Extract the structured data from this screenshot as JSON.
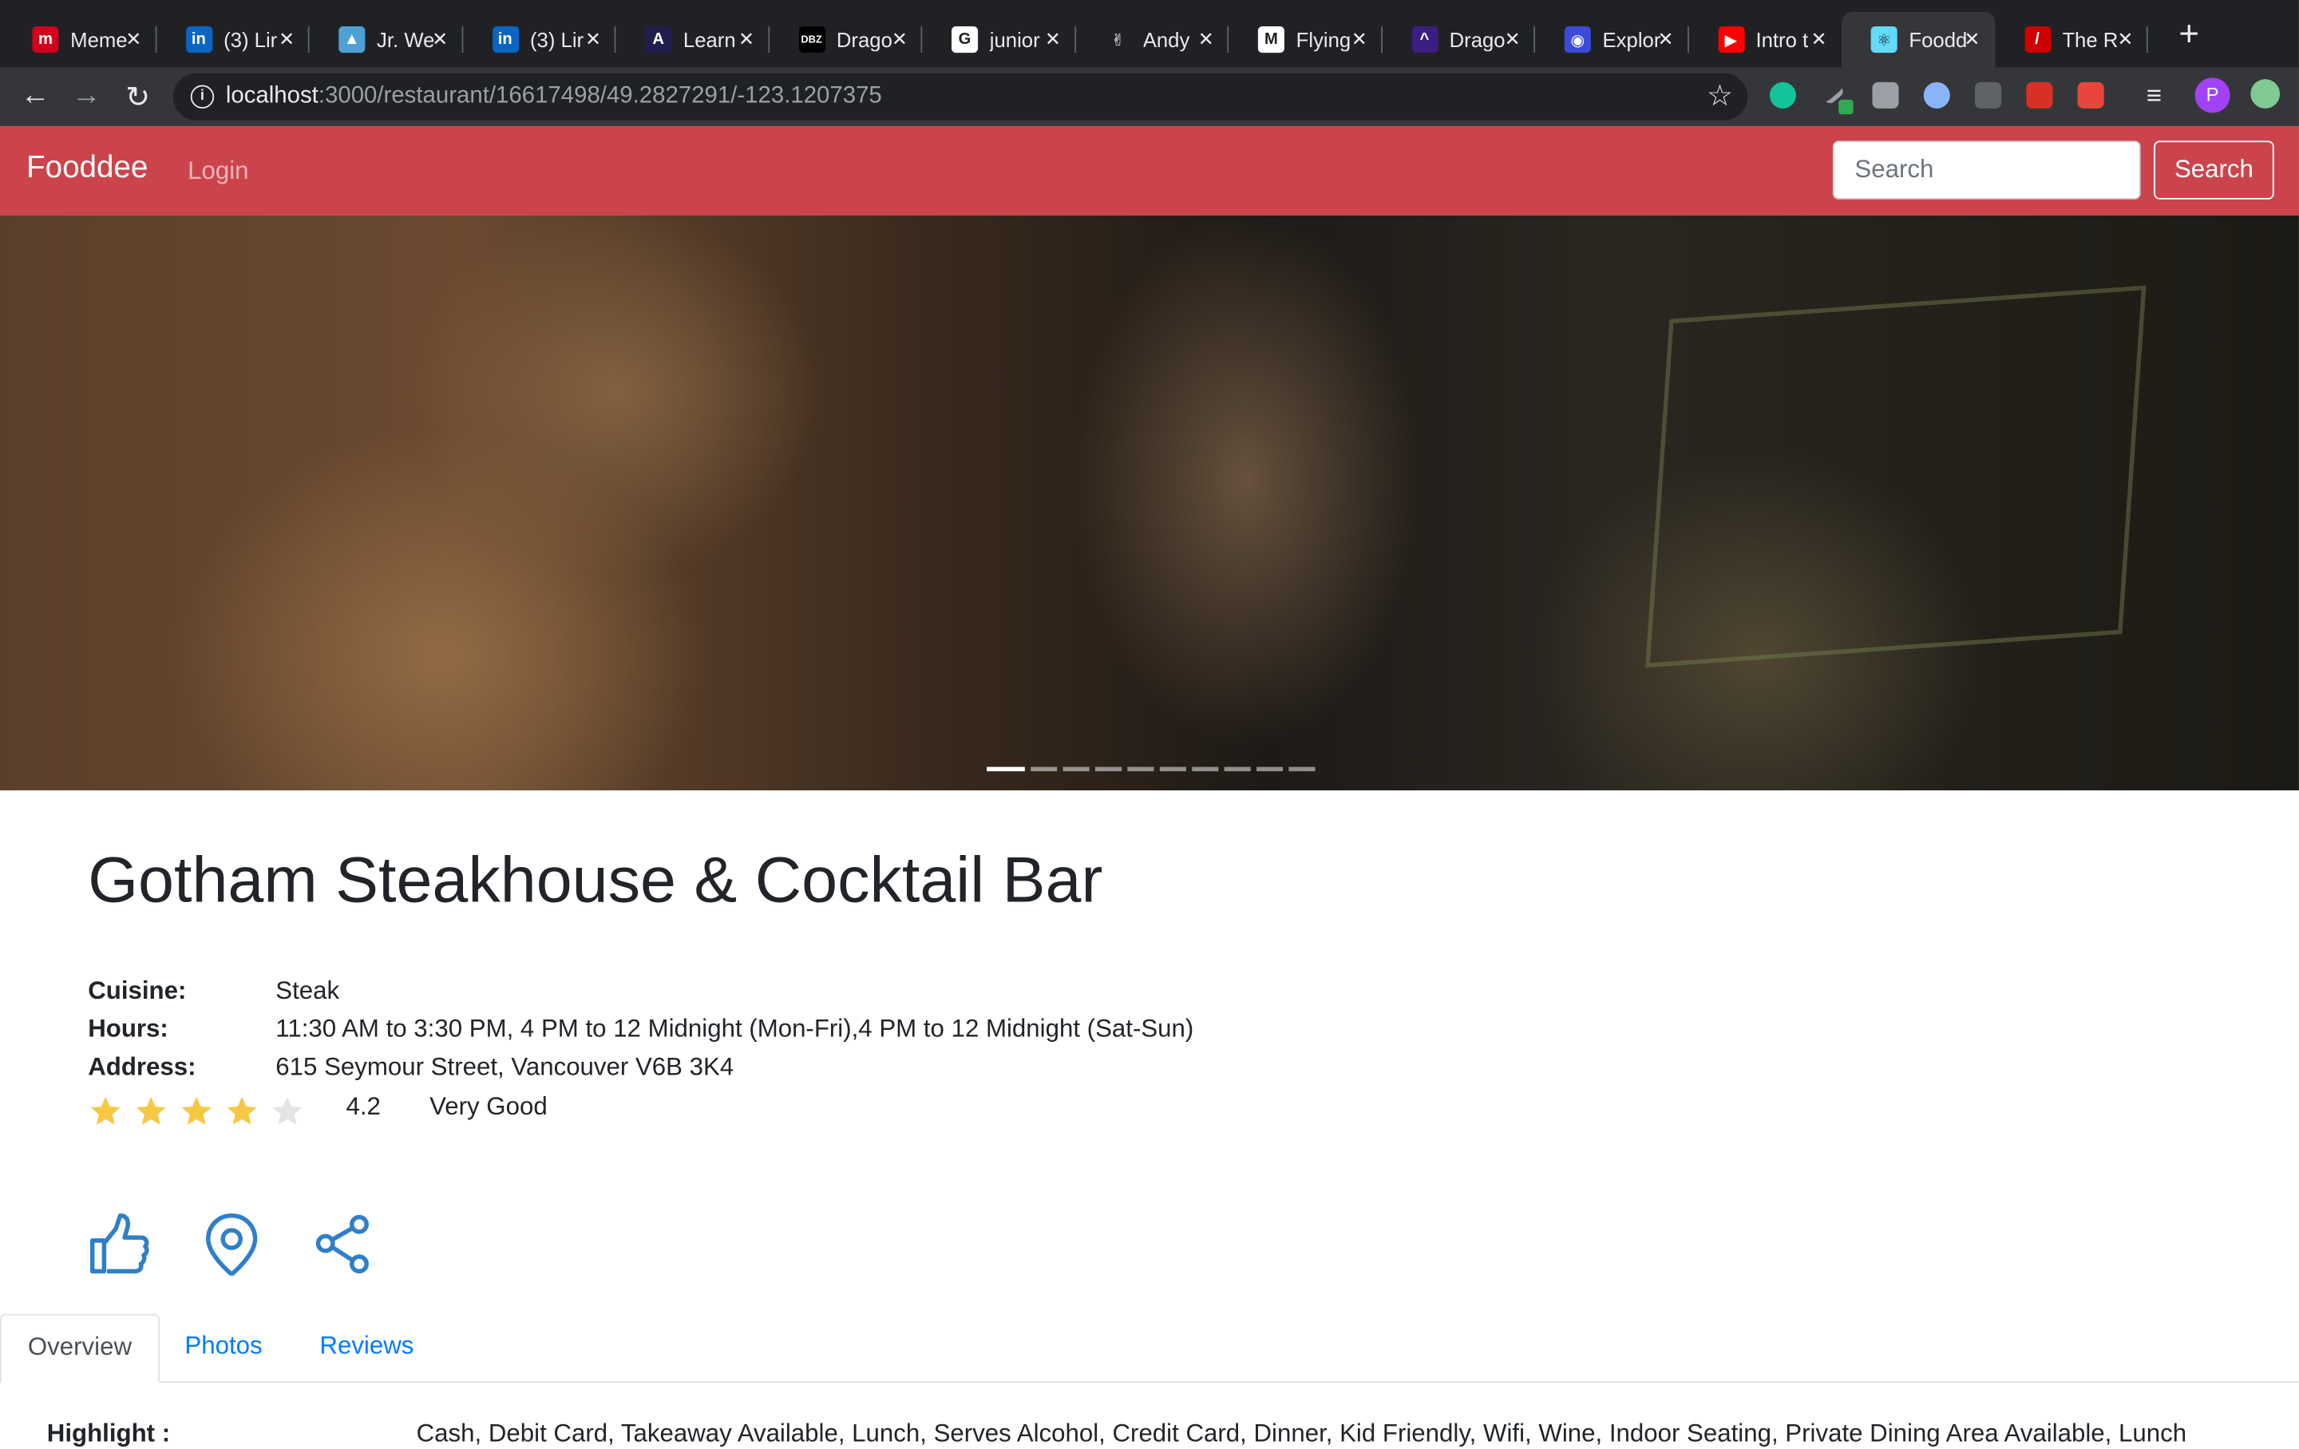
{
  "browser": {
    "tabs": [
      {
        "title": "Meme",
        "icon": "imgflip-icon",
        "color": "#d0021b",
        "glyph": "m"
      },
      {
        "title": "(3) Lir",
        "icon": "linkedin-icon",
        "color": "#0a66c2",
        "glyph": "in"
      },
      {
        "title": "Jr. We",
        "icon": "triangle-icon",
        "color": "#4ea1d3",
        "glyph": "▲"
      },
      {
        "title": "(3) Lir",
        "icon": "linkedin-icon",
        "color": "#0a66c2",
        "glyph": "in"
      },
      {
        "title": "Learn",
        "icon": "codecademy-icon",
        "color": "#1f1f4f",
        "glyph": "A"
      },
      {
        "title": "Drago",
        "icon": "dbz-icon",
        "color": "#000000",
        "glyph": "DBZ"
      },
      {
        "title": "junior",
        "icon": "google-icon",
        "color": "#ffffff",
        "glyph": "G"
      },
      {
        "title": "Andy",
        "icon": "peace-hand-icon",
        "color": "#202124",
        "glyph": "✌"
      },
      {
        "title": "Flying",
        "icon": "gmail-icon",
        "color": "#ffffff",
        "glyph": "M"
      },
      {
        "title": "Drago",
        "icon": "dragon-icon",
        "color": "#3c1e82",
        "glyph": "^"
      },
      {
        "title": "Explor",
        "icon": "discord-icon",
        "color": "#3b4bd8",
        "glyph": "◉"
      },
      {
        "title": "Intro t",
        "icon": "youtube-icon",
        "color": "#ff0000",
        "glyph": "▶"
      },
      {
        "title": "Foodd",
        "icon": "react-icon",
        "color": "#61dafb",
        "glyph": "⚛"
      },
      {
        "title": "The R",
        "icon": "rails-icon",
        "color": "#cc0000",
        "glyph": "/"
      }
    ],
    "active_tab_index": 12,
    "url_host": "localhost",
    "url_path": ":3000/restaurant/16617498/49.2827291/-123.1207375",
    "profile_initial": "P"
  },
  "navbar": {
    "brand": "Fooddee",
    "login": "Login",
    "search_placeholder": "Search",
    "search_button": "Search",
    "color": "#cc444b"
  },
  "carousel": {
    "slide_count": 10,
    "active_index": 0
  },
  "restaurant": {
    "name": "Gotham Steakhouse & Cocktail Bar",
    "cuisine_label": "Cuisine:",
    "cuisine": "Steak",
    "hours_label": "Hours:",
    "hours": "11:30 AM to 3:30 PM, 4 PM to 12 Midnight (Mon-Fri),4 PM to 12 Midnight (Sat-Sun)",
    "address_label": "Address:",
    "address": "615 Seymour Street, Vancouver V6B 3K4",
    "rating": "4.2",
    "rating_text": "Very Good",
    "stars_filled": 4,
    "stars_total": 5
  },
  "actions": [
    "like-icon",
    "location-pin-icon",
    "share-icon"
  ],
  "tabs": {
    "overview": "Overview",
    "photos": "Photos",
    "reviews": "Reviews"
  },
  "overview": {
    "highlight_label": "Highlight :",
    "highlights": "Cash, Debit Card, Takeaway Available, Lunch, Serves Alcohol, Credit Card, Dinner, Kid Friendly, Wifi, Wine, Indoor Seating, Private Dining Area Available, Lunch"
  }
}
